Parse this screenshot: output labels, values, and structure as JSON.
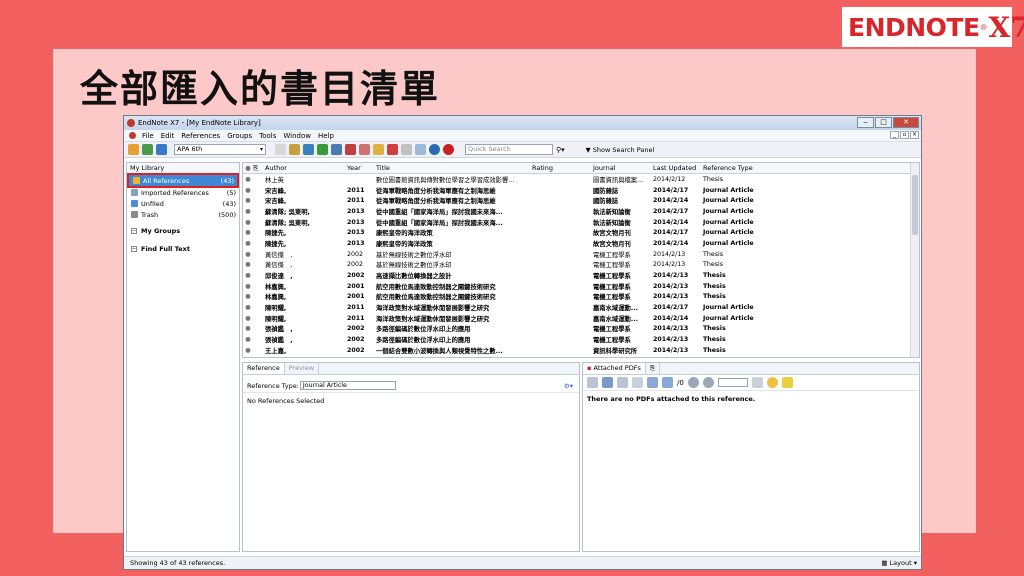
{
  "slide": {
    "title": "全部匯入的書目清單",
    "logo_text": "ENDNOTE",
    "logo_reg": "®",
    "logo_version": "X7"
  },
  "window": {
    "title": "EndNote X7 - [My EndNote Library]",
    "menu": [
      "File",
      "Edit",
      "References",
      "Groups",
      "Tools",
      "Window",
      "Help"
    ]
  },
  "toolbar": {
    "style": "APA 6th",
    "search_placeholder": "Quick Search",
    "show_search_panel": "Show Search Panel"
  },
  "sidebar": {
    "header": "My Library",
    "groups": [
      {
        "label": "All References",
        "count": "(43)",
        "icon_color": "#f0b428"
      },
      {
        "label": "Imported References",
        "count": "(5)",
        "icon_color": "#8aa0c0"
      },
      {
        "label": "Unfiled",
        "count": "(43)",
        "icon_color": "#4a90d9"
      },
      {
        "label": "Trash",
        "count": "(500)",
        "icon_color": "#8a8a8a"
      }
    ],
    "sections": [
      "My Groups",
      "Find Full Text"
    ]
  },
  "reflist": {
    "columns": {
      "author": "Author",
      "year": "Year",
      "title": "Title",
      "rating": "Rating",
      "journal": "Journal",
      "updated": "Last Updated",
      "type": "Reference Type"
    },
    "rows": [
      {
        "author": "林上英",
        "year": "",
        "title": "數位圖書館資訊與傳對數位學習之學習成效影響...",
        "journal": "圖書資訊與檔案...",
        "updated": "2014/2/12",
        "type": "Thesis",
        "bold": false
      },
      {
        "author": "宋吉峰,",
        "year": "2011",
        "title": "從海軍戰略角度分析我海軍應有之制海思維",
        "journal": "國防雜誌",
        "updated": "2014/2/17",
        "type": "Journal Article",
        "bold": true
      },
      {
        "author": "宋吉峰,",
        "year": "2011",
        "title": "從海軍戰略角度分析我海軍應有之制海思維",
        "journal": "國防雜誌",
        "updated": "2014/2/14",
        "type": "Journal Article",
        "bold": true
      },
      {
        "author": "蘇清隊; 吳東明,",
        "year": "2013",
        "title": "從中國重組「國家海洋局」探討我國未來海...",
        "journal": "執法新知論衡",
        "updated": "2014/2/17",
        "type": "Journal Article",
        "bold": true
      },
      {
        "author": "蘇清隊; 吳東明,",
        "year": "2013",
        "title": "從中國重組「國家海洋局」探討我國未來海...",
        "journal": "執法新知論衡",
        "updated": "2014/2/14",
        "type": "Journal Article",
        "bold": true
      },
      {
        "author": "陳捷先,",
        "year": "2013",
        "title": "康熙皇帝的海洋政策",
        "journal": "故宮文物月刊",
        "updated": "2014/2/17",
        "type": "Journal Article",
        "bold": true
      },
      {
        "author": "陳捷先,",
        "year": "2013",
        "title": "康熙皇帝的海洋政策",
        "journal": "故宮文物月刊",
        "updated": "2014/2/14",
        "type": "Journal Article",
        "bold": true
      },
      {
        "author": "黃信傑　,",
        "year": "2002",
        "title": "基於無線技術之數位浮水印",
        "journal": "電機工程學系",
        "updated": "2014/2/13",
        "type": "Thesis",
        "bold": false
      },
      {
        "author": "黃信傑　,",
        "year": "2002",
        "title": "基於無線技術之數位浮水印",
        "journal": "電機工程學系",
        "updated": "2014/2/13",
        "type": "Thesis",
        "bold": false
      },
      {
        "author": "邱俊達　,",
        "year": "2002",
        "title": "高速擷比數位轉換器之設計",
        "journal": "電機工程學系",
        "updated": "2014/2/13",
        "type": "Thesis",
        "bold": true
      },
      {
        "author": "林嘉興,",
        "year": "2001",
        "title": "航空用數位馬達致動控制器之關鍵技術研究",
        "journal": "電機工程學系",
        "updated": "2014/2/13",
        "type": "Thesis",
        "bold": true
      },
      {
        "author": "林嘉興,",
        "year": "2001",
        "title": "航空用數位馬達致動控制器之關鍵技術研究",
        "journal": "電機工程學系",
        "updated": "2014/2/13",
        "type": "Thesis",
        "bold": true
      },
      {
        "author": "陳明耀,",
        "year": "2011",
        "title": "海洋政策對水域運動休閒發展影響之研究",
        "journal": "嘉南水域運動...",
        "updated": "2014/2/17",
        "type": "Journal Article",
        "bold": true
      },
      {
        "author": "陳明耀,",
        "year": "2011",
        "title": "海洋政策對水域運動休閒發展影響之研究",
        "journal": "嘉南水域運動...",
        "updated": "2014/2/14",
        "type": "Journal Article",
        "bold": true
      },
      {
        "author": "張禎鑑　,",
        "year": "2002",
        "title": "多路徑編碼於數位浮水印上的應用",
        "journal": "電機工程學系",
        "updated": "2014/2/13",
        "type": "Thesis",
        "bold": true
      },
      {
        "author": "張禎鑑　,",
        "year": "2002",
        "title": "多路徑編碼於數位浮水印上的應用",
        "journal": "電機工程學系",
        "updated": "2014/2/13",
        "type": "Thesis",
        "bold": true
      },
      {
        "author": "王上嘉,",
        "year": "2002",
        "title": "一個結合雙數小波轉換與人類視覺特性之數...",
        "journal": "資訊科學研究所",
        "updated": "2014/2/13",
        "type": "Thesis",
        "bold": true
      }
    ]
  },
  "reference_pane": {
    "tabs": [
      "Reference",
      "Preview"
    ],
    "type_label": "Reference Type:",
    "type_value": "Journal Article",
    "empty_text": "No References Selected"
  },
  "pdf_pane": {
    "tab": "Attached PDFs",
    "page_counter": "/0",
    "empty_text": "There are no PDFs attached to this reference."
  },
  "status": {
    "text": "Showing 43 of 43 references.",
    "layout": "Layout"
  }
}
